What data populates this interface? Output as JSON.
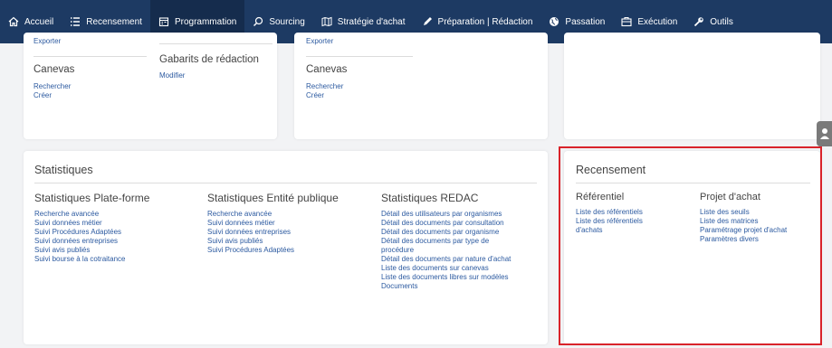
{
  "nav": {
    "items": [
      {
        "label": "Accueil",
        "icon": "home-icon"
      },
      {
        "label": "Recensement",
        "icon": "list-icon"
      },
      {
        "label": "Programmation",
        "icon": "calendar-icon"
      },
      {
        "label": "Sourcing",
        "icon": "search-icon"
      },
      {
        "label": "Stratégie d'achat",
        "icon": "map-icon"
      },
      {
        "label": "Préparation | Rédaction",
        "icon": "pen-icon"
      },
      {
        "label": "Passation",
        "icon": "globe-icon"
      },
      {
        "label": "Exécution",
        "icon": "briefcase-icon"
      },
      {
        "label": "Outils",
        "icon": "wrench-icon"
      }
    ],
    "active_index": 2,
    "colors": {
      "bar": "#1d3a63",
      "active": "#152c4d",
      "text": "#ffffff"
    }
  },
  "card1": {
    "export_link": "Exporter",
    "canevas": {
      "title": "Canevas",
      "links": [
        "Rechercher",
        "Créer"
      ]
    },
    "gabarits": {
      "title": "Gabarits de rédaction",
      "links": [
        "Modifier"
      ]
    }
  },
  "card2": {
    "export_link": "Exporter",
    "canevas": {
      "title": "Canevas",
      "links": [
        "Rechercher",
        "Créer"
      ]
    }
  },
  "statistiques": {
    "title": "Statistiques",
    "columns": [
      {
        "title": "Statistiques Plate-forme",
        "links": [
          "Recherche avancée",
          "Suivi données métier",
          "Suivi Procédures Adaptées",
          "Suivi données entreprises",
          "Suivi avis publiés",
          "Suivi bourse à la cotraitance"
        ]
      },
      {
        "title": "Statistiques Entité publique",
        "links": [
          "Recherche avancée",
          "Suivi données métier",
          "Suivi données entreprises",
          "Suivi avis publiés",
          "Suivi Procédures Adaptées"
        ]
      },
      {
        "title": "Statistiques REDAC",
        "links": [
          "Détail des utilisateurs par organismes",
          "Détail des documents par consultation",
          "Détail des documents par organisme",
          "Détail des documents par type de procédure",
          "Détail des documents par nature d'achat",
          "Liste des documents sur canevas",
          "Liste des documents libres sur modèles Documents"
        ]
      }
    ]
  },
  "recensement": {
    "title": "Recensement",
    "columns": [
      {
        "title": "Référentiel",
        "links": [
          "Liste des référentiels",
          "Liste des référentiels d'achats"
        ]
      },
      {
        "title": "Projet d'achat",
        "links": [
          "Liste des seuils",
          "Liste des matrices",
          "Paramétrage projet d'achat",
          "Paramètres divers"
        ]
      }
    ]
  },
  "colors": {
    "link": "#2c5aa0",
    "highlight": "#d9232a",
    "background": "#f2f3f5"
  }
}
